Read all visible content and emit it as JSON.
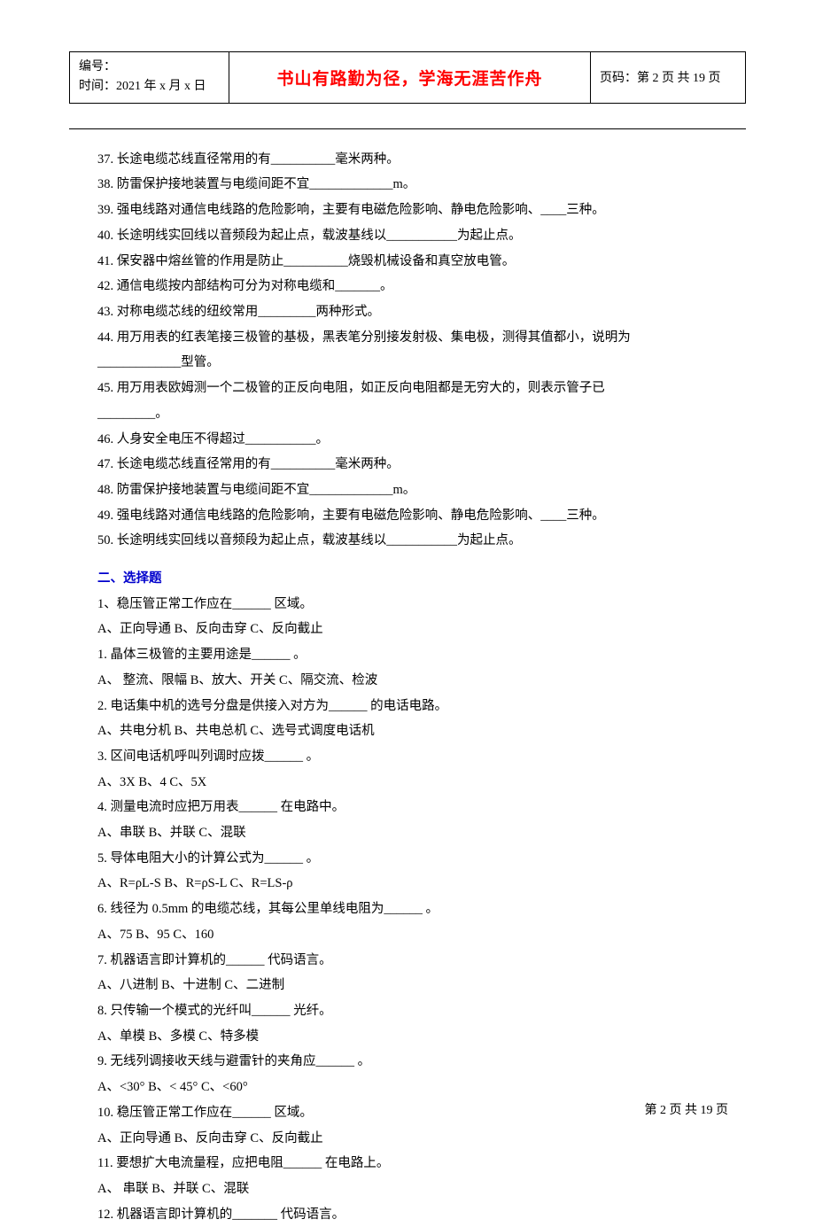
{
  "header": {
    "left_line1": "编号：",
    "left_line2": "时间：2021 年 x 月 x 日",
    "center": "书山有路勤为径，学海无涯苦作舟",
    "right": "页码：第 2 页 共 19 页"
  },
  "fill_questions": [
    "37. 长途电缆芯线直径常用的有__________毫米两种。",
    "38. 防雷保护接地装置与电缆间距不宜_____________m。",
    "39. 强电线路对通信电线路的危险影响，主要有电磁危险影响、静电危险影响、____三种。",
    "40. 长途明线实回线以音频段为起止点，载波基线以___________为起止点。",
    "41. 保安器中熔丝管的作用是防止__________烧毁机械设备和真空放电管。",
    "42. 通信电缆按内部结构可分为对称电缆和_______。",
    "43. 对称电缆芯线的纽绞常用_________两种形式。",
    "44. 用万用表的红表笔接三极管的基极，黑表笔分别接发射极、集电极，测得其值都小，说明为",
    "_____________型管。",
    "45. 用万用表欧姆测一个二极管的正反向电阻，如正反向电阻都是无穷大的，则表示管子已",
    "_________。",
    "46. 人身安全电压不得超过___________。",
    "47. 长途电缆芯线直径常用的有__________毫米两种。",
    "48. 防雷保护接地装置与电缆间距不宜_____________m。",
    "49. 强电线路对通信电线路的危险影响，主要有电磁危险影响、静电危险影响、____三种。",
    "50. 长途明线实回线以音频段为起止点，载波基线以___________为起止点。"
  ],
  "section2_title": "二、选择题",
  "choice_questions": [
    "1、稳压管正常工作应在______ 区域。",
    "A、正向导通 B、反向击穿 C、反向截止",
    "1. 晶体三极管的主要用途是______ 。",
    "A、 整流、限幅 B、放大、开关 C、隔交流、检波",
    "2. 电话集中机的选号分盘是供接入对方为______ 的电话电路。",
    "A、共电分机 B、共电总机 C、选号式调度电话机",
    "3. 区间电话机呼叫列调时应拨______ 。",
    "A、3X B、4 C、5X",
    "4. 测量电流时应把万用表______ 在电路中。",
    "A、串联 B、并联 C、混联",
    "5. 导体电阻大小的计算公式为______ 。",
    "A、R=ρL-S B、R=ρS-L C、R=LS-ρ",
    "6. 线径为 0.5mm 的电缆芯线，其每公里单线电阻为______ 。",
    "A、75 B、95 C、160",
    "7. 机器语言即计算机的______ 代码语言。",
    "A、八进制 B、十进制 C、二进制",
    "8. 只传输一个模式的光纤叫______ 光纤。",
    "A、单模 B、多模 C、特多模",
    "9. 无线列调接收天线与避雷针的夹角应______ 。",
    "A、<30° B、< 45° C、<60°",
    "10. 稳压管正常工作应在______ 区域。",
    "A、正向导通 B、反向击穿 C、反向截止",
    "11. 要想扩大电流量程，应把电阻______ 在电路上。",
    "A、 串联 B、并联 C、混联",
    "12. 机器语言即计算机的_______ 代码语言。"
  ],
  "footer": "第 2 页 共 19 页"
}
